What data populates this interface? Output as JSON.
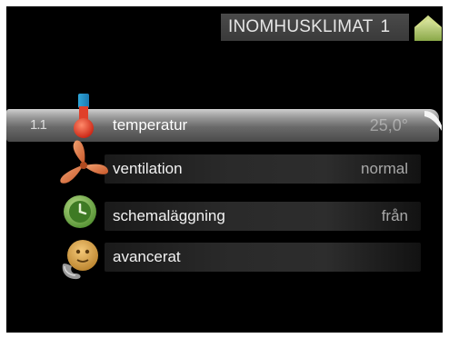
{
  "header": {
    "title": "INOMHUSKLIMAT",
    "number": "1"
  },
  "menu": {
    "items": [
      {
        "index": "1.1",
        "label": "temperatur",
        "value": "25,0°",
        "icon": "thermometer-icon"
      },
      {
        "label": "ventilation",
        "value": "normal",
        "icon": "fan-icon"
      },
      {
        "label": "schemaläggning",
        "value": "från",
        "icon": "clock-icon"
      },
      {
        "label": "avancerat",
        "value": "",
        "icon": "advanced-face-icon"
      }
    ]
  },
  "colors": {
    "background": "#000000",
    "selected_bar": "#9a9a9a",
    "accent_green": "#6aa84f",
    "accent_red": "#e0402a",
    "accent_orange": "#e07a3a"
  }
}
